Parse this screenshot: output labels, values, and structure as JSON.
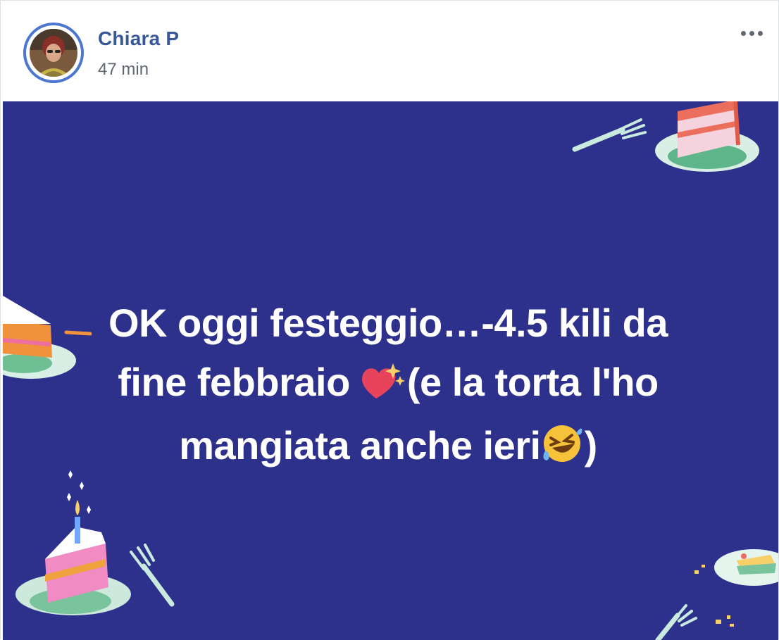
{
  "post": {
    "author": "Chiara P",
    "timestamp": "47 min",
    "more_icon": "ellipsis-icon",
    "text_line1": "OK oggi festeggio…-4.5 kili da",
    "text_line2_a": "fine febbraio ",
    "text_line2_b": "(e la torta l'ho",
    "text_line3_a": "mangiata anche ieri",
    "text_line3_b": ")",
    "emoji_1": "sparkling-heart-icon",
    "emoji_2": "rolling-laughing-icon",
    "background_color": "#2e318c",
    "author_color": "#385898"
  }
}
